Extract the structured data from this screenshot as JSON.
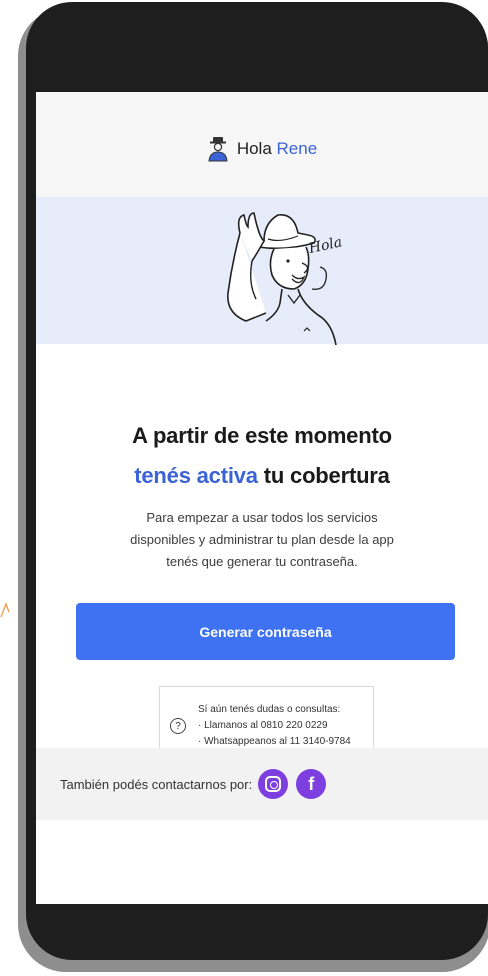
{
  "header": {
    "greeting": "Hola",
    "name": "Rene"
  },
  "hero": {
    "hat_text": "Hola"
  },
  "main": {
    "title_line1": "A partir de este momento",
    "title_line2_accent": "tenés activa",
    "title_line2_rest": " tu cobertura",
    "body_line1": "Para empezar a usar todos los servicios",
    "body_line2": "disponibles y administrar tu plan desde la app",
    "body_line3": "tenés que generar tu contraseña.",
    "cta_label": "Generar contraseña"
  },
  "help": {
    "icon": "question-icon",
    "line1": "Sí aún tenés dudas o consultas:",
    "line2": "· Llamanos al 0810 220 0229",
    "line3": "· Whatsappeanos al 11 3140-9784"
  },
  "footer": {
    "text": "También podés contactarnos por:",
    "fb_letter": "f"
  },
  "colors": {
    "accent": "#3b63d6",
    "button": "#3e72f3",
    "hero_bg": "#e6ecfa",
    "social": "#7d3fe0"
  }
}
